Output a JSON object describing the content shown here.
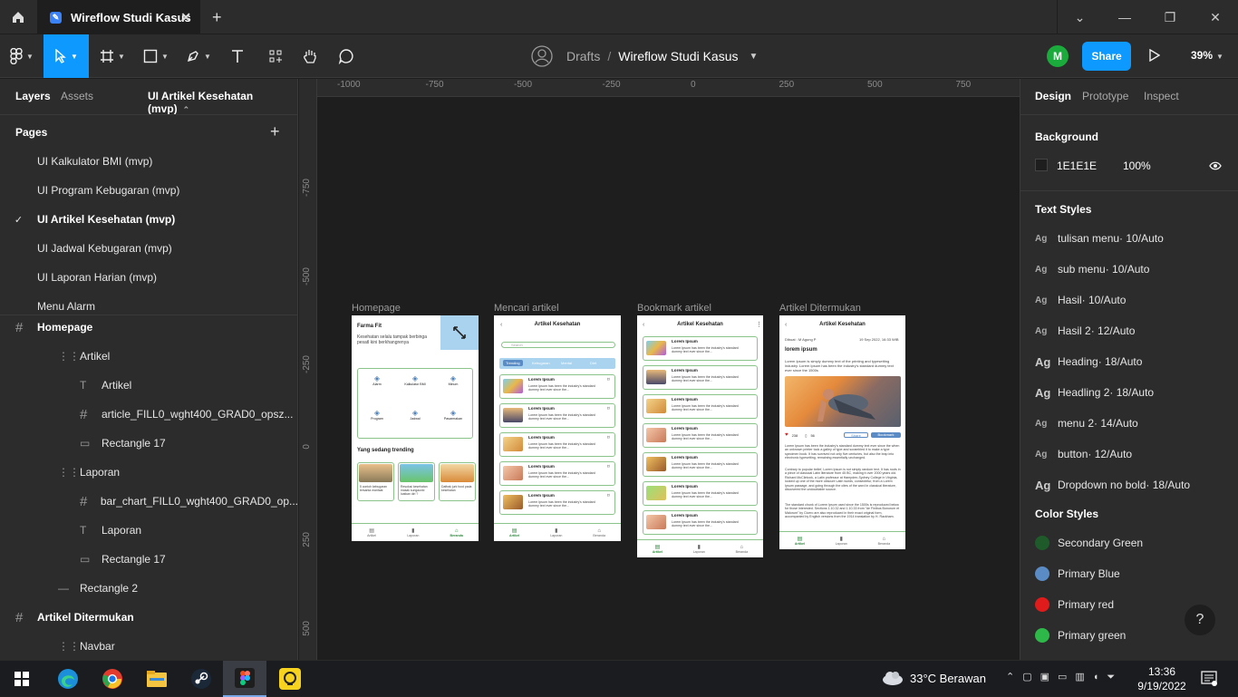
{
  "tabs": {
    "home_label": "Home",
    "active_tab": "Wireflow Studi Kasus",
    "new_tab": "+"
  },
  "window": {
    "minimize": "—",
    "restore": "❐",
    "close": "✕",
    "chevron": "⌄"
  },
  "toolbar": {
    "breadcrumb_root": "Drafts",
    "separator": "/",
    "file_name": "Wireflow Studi Kasus",
    "avatar_letter": "M",
    "share_label": "Share",
    "zoom": "39%"
  },
  "left_panel": {
    "tab_layers": "Layers",
    "tab_assets": "Assets",
    "page_selector": "UI Artikel Kesehatan (mvp)",
    "pages_title": "Pages",
    "pages": [
      {
        "label": "UI Kalkulator BMI (mvp)",
        "selected": false
      },
      {
        "label": "UI Program Kebugaran (mvp)",
        "selected": false
      },
      {
        "label": "UI Artikel Kesehatan (mvp)",
        "selected": true
      },
      {
        "label": "UI Jadwal Kebugaran (mvp)",
        "selected": false
      },
      {
        "label": "UI Laporan Harian (mvp)",
        "selected": false
      },
      {
        "label": "Menu Alarm",
        "selected": false
      }
    ],
    "layers": [
      {
        "label": "Homepage",
        "icon": "frame-icon",
        "indent": 0,
        "bold": true
      },
      {
        "label": "Artikel",
        "icon": "group-icon",
        "indent": 1,
        "bold": false
      },
      {
        "label": "Artikel",
        "icon": "text-icon",
        "indent": 2,
        "bold": false
      },
      {
        "label": "article_FILL0_wght400_GRAD0_opsz...",
        "icon": "frame-icon",
        "indent": 2,
        "bold": false
      },
      {
        "label": "Rectangle 17",
        "icon": "rectangle-icon",
        "indent": 2,
        "bold": false
      },
      {
        "label": "Laporan",
        "icon": "group-icon",
        "indent": 1,
        "bold": false
      },
      {
        "label": "bar_chart_FILL0_wght400_GRAD0_op...",
        "icon": "frame-icon",
        "indent": 2,
        "bold": false
      },
      {
        "label": "Laporan",
        "icon": "text-icon",
        "indent": 2,
        "bold": false
      },
      {
        "label": "Rectangle 17",
        "icon": "rectangle-icon",
        "indent": 2,
        "bold": false
      },
      {
        "label": "Rectangle 2",
        "icon": "line-icon",
        "indent": 1,
        "bold": false
      },
      {
        "label": "Artikel Ditermukan",
        "icon": "frame-icon",
        "indent": 0,
        "bold": true
      },
      {
        "label": "Navbar",
        "icon": "group-icon",
        "indent": 1,
        "bold": false
      }
    ]
  },
  "rulers": {
    "h_ticks": [
      "-1000",
      "-750",
      "-500",
      "-250",
      "0",
      "250",
      "500",
      "750"
    ],
    "v_ticks": [
      "-750",
      "-500",
      "-250",
      "0",
      "250",
      "500"
    ]
  },
  "frames": {
    "homepage": {
      "label": "Homepage",
      "app_name": "Farma Fit",
      "tagline": "Kesehatan selalu tampak berbinga pesatl kini berkhangrenya",
      "menu": [
        "Alarm",
        "Kalkulator BMI",
        "Minum",
        "Program",
        "Jadwal",
        "Pasarmakan"
      ],
      "trending_title": "Yang sedang trending",
      "trending": [
        "5 contoh kebugaran tersanta manfaat",
        "Resolusi kesehatan masak sungaunki loatkan diri ?",
        "Daftrak jurk food pada kesehatan"
      ],
      "nav": [
        "Artikel",
        "Laporan",
        "Beranda"
      ]
    },
    "search": {
      "label": "Mencari artikel",
      "title": "Artikel Kesehatan",
      "search_placeholder": "Search",
      "chips": [
        "Trending",
        "Kebugaran",
        "Mental",
        "Diet"
      ],
      "item_title": "Lorem Ipsum",
      "item_text": "Lorem Ipsum has been the industry's standard dummy text ever since the...",
      "nav": [
        "Artikel",
        "Laporan",
        "Beranda"
      ]
    },
    "bookmark": {
      "label": "Bookmark artikel",
      "title": "Artikel Kesehatan",
      "item_title": "Lorem Ipsum",
      "item_text": "Lorem Ipsum has been the industry's standard dummy text ever since the...",
      "nav": [
        "Artikel",
        "Laporan",
        "Beranda"
      ]
    },
    "found": {
      "label": "Artikel Ditermukan",
      "title": "Artikel Kesehatan",
      "author": "Dibuat : M Agung P",
      "date": "19 Sep 2022, 16:33 WIB",
      "heading": "lorem ipsum",
      "intro": "Lorem Ipsum is simply dummy text of the printing and typesetting industry. Lorem Ipsum has been the industry's standard dummy text ever since the 1500s",
      "likes": "238",
      "comments": "56",
      "share_label": "Share",
      "bookmark_label": "Bookmark",
      "body1": "Lorem Ipsum has been the industry's standard dummy text ever since the when an unknown printer took a galley of type and scrambled it to make a type specimen book. It has survived not only five centuries, but also the leap into electronic typesetting, remaining essentially unchanged.",
      "body2": "Contrary to popular belief, Lorem Ipsum is not simply random text. It has roots in a piece of classical Latin literature from 45 BC, making it over 2000 years old. Richard McClintock, a Latin professor at Hampden-Sydney College in Virginia, looked up one of the more obscure Latin words, consectetur, from a Lorem Ipsum passage, and going through the cites of the word in classical literature, discovered the undoubtable source.",
      "body3": "The standard chunk of Lorem Ipsum used since the 1500s is reproduced below for those interested. Sections 1.10.32 and 1.10.33 from \"de Finibus Bonorum et Malorum\" by Cicero are also reproduced in their exact original form, accompanied by English versions from the 1914 translation by H. Rackham.",
      "nav": [
        "Artikel",
        "Laporan",
        "Beranda"
      ]
    }
  },
  "right_panel": {
    "tabs": [
      "Design",
      "Prototype",
      "Inspect"
    ],
    "background_title": "Background",
    "bg_hex": "1E1E1E",
    "bg_opacity": "100%",
    "bg_color": "#1e1e1e",
    "text_styles_title": "Text Styles",
    "text_styles": [
      {
        "name": "tulisan menu",
        "spec": " · 10/Auto",
        "big": false
      },
      {
        "name": "sub menu",
        "spec": " · 10/Auto",
        "big": false
      },
      {
        "name": "Hasil",
        "spec": " · 10/Auto",
        "big": false
      },
      {
        "name": "Hasil 2",
        "spec": " · 12/Auto",
        "big": false
      },
      {
        "name": "Heading",
        "spec": " · 18/Auto",
        "big": true
      },
      {
        "name": "Headling 2",
        "spec": " · 18/Auto",
        "big": true
      },
      {
        "name": "menu 2",
        "spec": " · 14/Auto",
        "big": false
      },
      {
        "name": "button",
        "spec": " · 12/Auto",
        "big": false
      },
      {
        "name": "Dropdown no bold",
        "spec": " · 18/Auto",
        "big": true
      }
    ],
    "color_styles_title": "Color Styles",
    "color_styles": [
      {
        "name": "Secondary Green",
        "color": "#1f5a2a"
      },
      {
        "name": "Primary Blue",
        "color": "#5a8bc4"
      },
      {
        "name": "Primary red",
        "color": "#e01b1b"
      },
      {
        "name": "Primary green",
        "color": "#2fb84a"
      }
    ],
    "help": "?"
  },
  "taskbar": {
    "weather": "33°C  Berawan",
    "time": "13:36",
    "date": "9/19/2022"
  },
  "colors": {
    "accent": "#0d99ff",
    "figma_bg": "#2c2c2c",
    "canvas": "#1e1e1e",
    "green": "#2e8b3d"
  }
}
